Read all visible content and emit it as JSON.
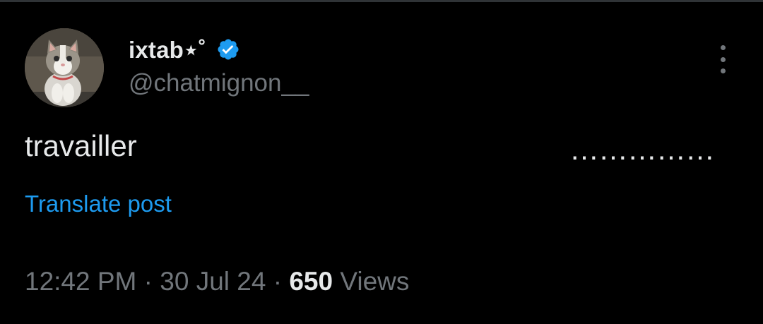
{
  "colors": {
    "background": "#000000",
    "primary_text": "#e7e9ea",
    "secondary_text": "#71767b",
    "link": "#1d9bf0",
    "verified_badge": "#1d9bf0",
    "divider": "#2f3336"
  },
  "post": {
    "author": {
      "display_name": "ixtab⋆˚",
      "handle": "@chatmignon__",
      "verified": true,
      "avatar_icon": "cat-avatar-image",
      "verified_icon": "verified-badge-icon"
    },
    "more_icon": "more-vertical-icon",
    "text": "travailler",
    "trailing_dots": "……………",
    "translate_label": "Translate post",
    "meta": {
      "time": "12:42 PM",
      "separator": " · ",
      "date": "30 Jul 24",
      "views_count": "650",
      "views_label": "Views"
    }
  }
}
